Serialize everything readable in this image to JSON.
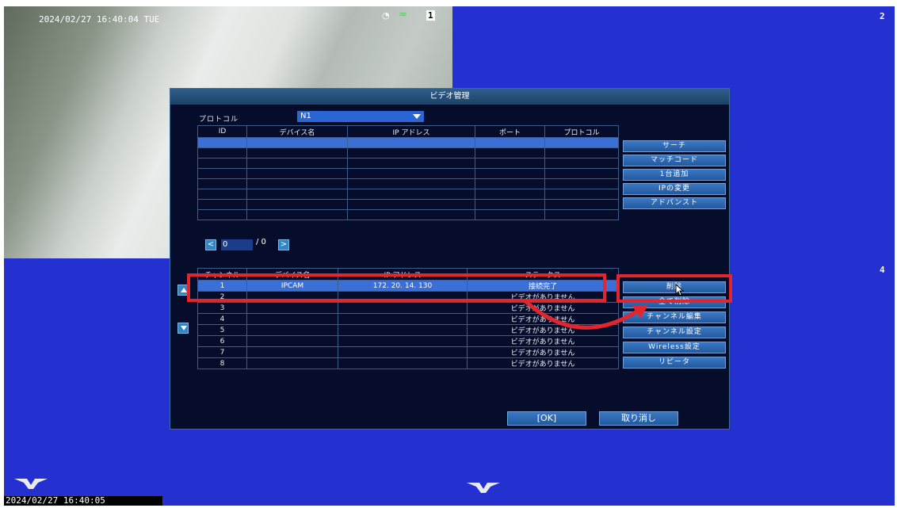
{
  "screen": {
    "cam_timestamp": "2024/02/27 16:40:04 TUE",
    "channel_labels": [
      "1",
      "2",
      "4"
    ],
    "bottom_clock": "2024/02/27 16:40:05"
  },
  "dialog": {
    "title": "ビデオ管理",
    "protocol_label": "プロトコル",
    "protocol_value": "N1",
    "search_table": {
      "headers": [
        "ID",
        "デバイス名",
        "IP アドレス",
        "ポート",
        "プロトコル"
      ],
      "rows": [
        [
          "",
          "",
          "",
          "",
          ""
        ],
        [
          "",
          "",
          "",
          "",
          ""
        ],
        [
          "",
          "",
          "",
          "",
          ""
        ],
        [
          "",
          "",
          "",
          "",
          ""
        ],
        [
          "",
          "",
          "",
          "",
          ""
        ],
        [
          "",
          "",
          "",
          "",
          ""
        ],
        [
          "",
          "",
          "",
          "",
          ""
        ],
        [
          "",
          "",
          "",
          "",
          ""
        ]
      ]
    },
    "right_buttons_top": [
      "サーチ",
      "マッチコード",
      "1台追加",
      "IPの変更",
      "アドバンスト"
    ],
    "pager": {
      "current": "0",
      "separator": "/ 0",
      "prev": "<",
      "next": ">"
    },
    "channel_table": {
      "headers": [
        "チャンネル",
        "デバイス名",
        "IP アドレス",
        "ステータス"
      ],
      "rows": [
        [
          "1",
          "IPCAM",
          "172. 20. 14. 130",
          "接続完了"
        ],
        [
          "2",
          "",
          "",
          "ビデオがありません"
        ],
        [
          "3",
          "",
          "",
          "ビデオがありません"
        ],
        [
          "4",
          "",
          "",
          "ビデオがありません"
        ],
        [
          "5",
          "",
          "",
          "ビデオがありません"
        ],
        [
          "6",
          "",
          "",
          "ビデオがありません"
        ],
        [
          "7",
          "",
          "",
          "ビデオがありません"
        ],
        [
          "8",
          "",
          "",
          "ビデオがありません"
        ]
      ]
    },
    "right_buttons_bottom": [
      "削除",
      "全て削除",
      "チャンネル編集",
      "チャンネル設定",
      "Wireless設定",
      "リピータ"
    ],
    "ok_label": "[OK]",
    "cancel_label": "取り消し"
  },
  "colors": {
    "screen_bg": "#2431d0",
    "dialog_bg": "#050d2b",
    "highlight": "#e3262e",
    "selected_row": "#3a6fd6"
  }
}
